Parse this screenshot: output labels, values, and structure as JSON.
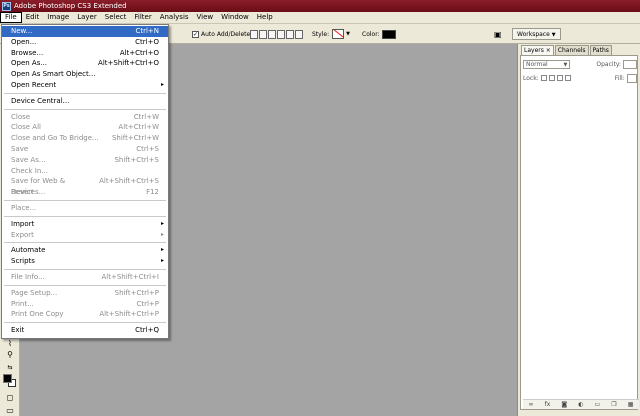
{
  "title_bar": {
    "title": "Adobe Photoshop CS3 Extended",
    "logo": "Ps"
  },
  "menu_bar": [
    "File",
    "Edit",
    "Image",
    "Layer",
    "Select",
    "Filter",
    "Analysis",
    "View",
    "Window",
    "Help"
  ],
  "options_bar": {
    "auto_add_label": "Auto Add/Delete",
    "style_label": "Style:",
    "color_label": "Color:",
    "workspace_label": "Workspace",
    "workspace_arrow": "▼"
  },
  "panel": {
    "tabs": [
      "Layers ×",
      "Channels",
      "Paths"
    ],
    "blend_mode": "Normal",
    "opacity_label": "Opacity:",
    "lock_label": "Lock:",
    "fill_label": "Fill:",
    "footer_icons": [
      "link-icon",
      "fx-icon",
      "mask-icon",
      "adjustment-icon",
      "folder-icon",
      "new-layer-icon",
      "trash-icon"
    ]
  },
  "file_menu": {
    "groups": [
      [
        {
          "label": "New...",
          "shortcut": "Ctrl+N",
          "enabled": true,
          "highlighted": true
        },
        {
          "label": "Open...",
          "shortcut": "Ctrl+O",
          "enabled": true
        },
        {
          "label": "Browse...",
          "shortcut": "Alt+Ctrl+O",
          "enabled": true
        },
        {
          "label": "Open As...",
          "shortcut": "Alt+Shift+Ctrl+O",
          "enabled": true
        },
        {
          "label": "Open As Smart Object...",
          "shortcut": "",
          "enabled": true
        },
        {
          "label": "Open Recent",
          "shortcut": "",
          "enabled": true,
          "submenu": true
        }
      ],
      [
        {
          "label": "Device Central...",
          "shortcut": "",
          "enabled": true
        }
      ],
      [
        {
          "label": "Close",
          "shortcut": "Ctrl+W",
          "enabled": false
        },
        {
          "label": "Close All",
          "shortcut": "Alt+Ctrl+W",
          "enabled": false
        },
        {
          "label": "Close and Go To Bridge...",
          "shortcut": "Shift+Ctrl+W",
          "enabled": false
        },
        {
          "label": "Save",
          "shortcut": "Ctrl+S",
          "enabled": false
        },
        {
          "label": "Save As...",
          "shortcut": "Shift+Ctrl+S",
          "enabled": false
        },
        {
          "label": "Check In...",
          "shortcut": "",
          "enabled": false
        },
        {
          "label": "Save for Web & Devices...",
          "shortcut": "Alt+Shift+Ctrl+S",
          "enabled": false
        },
        {
          "label": "Revert",
          "shortcut": "F12",
          "enabled": false
        }
      ],
      [
        {
          "label": "Place...",
          "shortcut": "",
          "enabled": false
        }
      ],
      [
        {
          "label": "Import",
          "shortcut": "",
          "enabled": true,
          "submenu": true
        },
        {
          "label": "Export",
          "shortcut": "",
          "enabled": false,
          "submenu": true
        }
      ],
      [
        {
          "label": "Automate",
          "shortcut": "",
          "enabled": true,
          "submenu": true
        },
        {
          "label": "Scripts",
          "shortcut": "",
          "enabled": true,
          "submenu": true
        }
      ],
      [
        {
          "label": "File Info...",
          "shortcut": "Alt+Shift+Ctrl+I",
          "enabled": false
        }
      ],
      [
        {
          "label": "Page Setup...",
          "shortcut": "Shift+Ctrl+P",
          "enabled": false
        },
        {
          "label": "Print...",
          "shortcut": "Ctrl+P",
          "enabled": false
        },
        {
          "label": "Print One Copy",
          "shortcut": "Alt+Shift+Ctrl+P",
          "enabled": false
        }
      ],
      [
        {
          "label": "Exit",
          "shortcut": "Ctrl+Q",
          "enabled": true
        }
      ]
    ]
  },
  "colors": {
    "titlebar": "#7a1521",
    "menu_highlight": "#316ac5",
    "canvas": "#a4a4a4",
    "chrome": "#ece9d8"
  }
}
